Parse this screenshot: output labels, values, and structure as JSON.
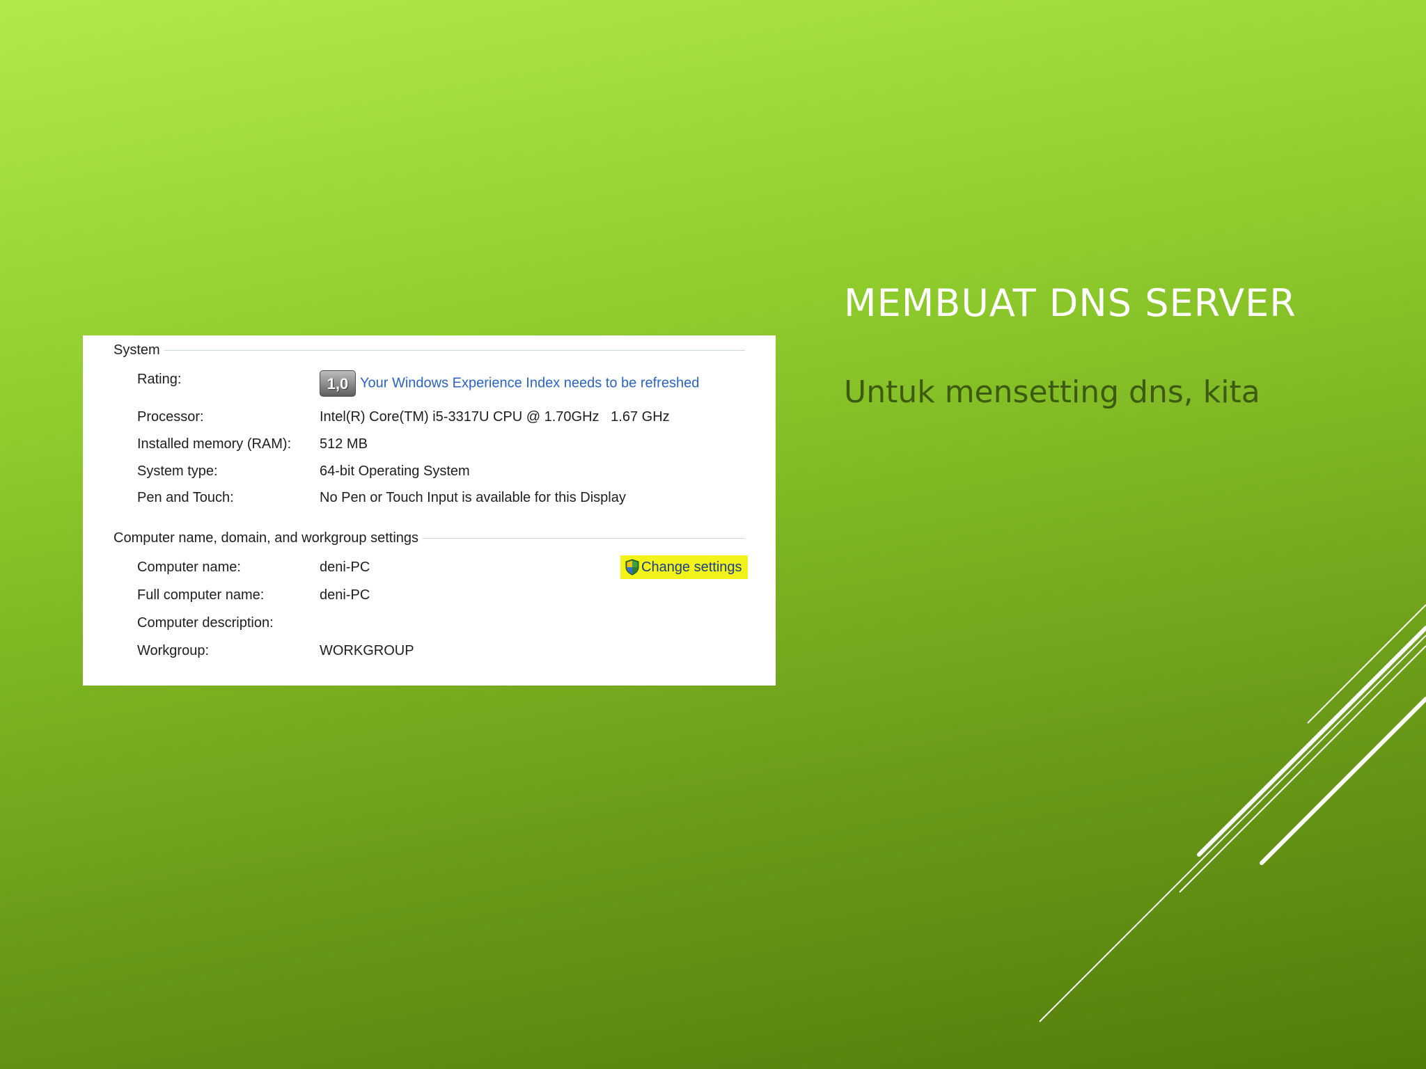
{
  "slide": {
    "title": "MEMBUAT DNS SERVER",
    "subtitle": "Untuk mensetting dns, kita"
  },
  "system_properties": {
    "system_group": {
      "header": "System",
      "rating": {
        "label": "Rating:",
        "badge": "1,0",
        "link": "Your Windows Experience Index needs to be refreshed"
      },
      "processor": {
        "label": "Processor:",
        "value": "Intel(R) Core(TM) i5-3317U CPU @ 1.70GHz   1.67 GHz"
      },
      "memory": {
        "label": "Installed memory (RAM):",
        "value": "512 MB"
      },
      "system_type": {
        "label": "System type:",
        "value": "64-bit Operating System"
      },
      "pen_touch": {
        "label": "Pen and Touch:",
        "value": "No Pen or Touch Input is available for this Display"
      }
    },
    "computer_group": {
      "header": "Computer name, domain, and workgroup settings",
      "computer_name": {
        "label": "Computer name:",
        "value": "deni-PC"
      },
      "full_computer_name": {
        "label": "Full computer name:",
        "value": "deni-PC"
      },
      "description": {
        "label": "Computer description:",
        "value": ""
      },
      "workgroup": {
        "label": "Workgroup:",
        "value": "WORKGROUP"
      },
      "change_settings": {
        "label": "Change settings",
        "icon": "uac-shield-icon",
        "highlight_color": "#f3f31a"
      }
    }
  },
  "colors": {
    "background_top": "#b3e84a",
    "background_bottom": "#527c0a",
    "title_color": "#ffffff",
    "subtitle_color": "#3d5a10",
    "link_color": "#2a63c8"
  }
}
